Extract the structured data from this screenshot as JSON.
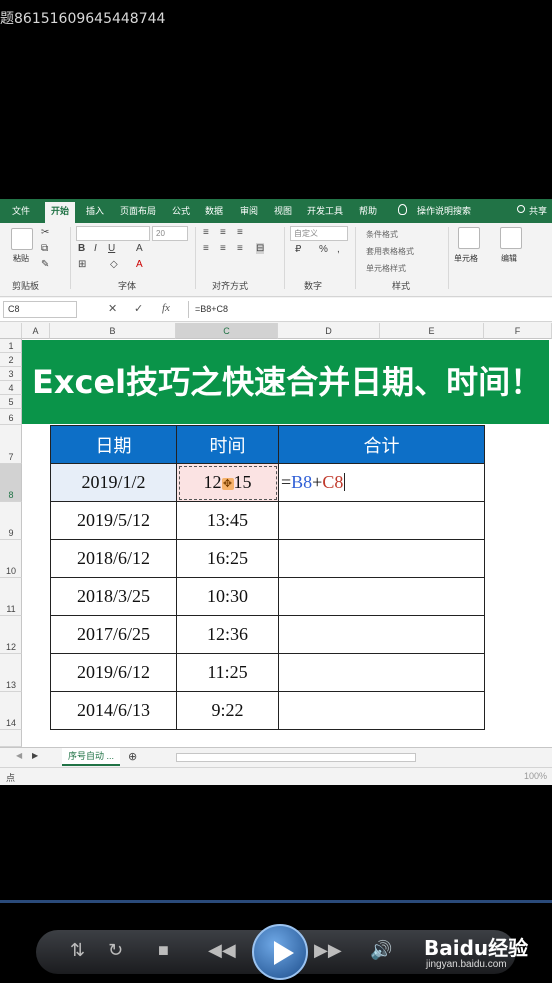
{
  "caption": "题86151609645448744",
  "excel": {
    "tabs": [
      "文件",
      "开始",
      "插入",
      "页面布局",
      "公式",
      "数据",
      "审阅",
      "视图",
      "开发工具",
      "帮助"
    ],
    "tell_me": "操作说明搜索",
    "share": "共享",
    "ribbon": {
      "clipboard_label": "剪贴板",
      "paste_label": "粘贴",
      "font_label": "字体",
      "font_size": "20",
      "align_label": "对齐方式",
      "number_label": "数字",
      "number_format": "自定义",
      "styles_label": "样式",
      "cond_format": "条件格式",
      "table_format": "套用表格格式",
      "cell_styles": "单元格样式",
      "cells_label": "单元格",
      "edit_label": "编辑"
    },
    "name_box": "C8",
    "formula": "=B8+C8",
    "columns": [
      "A",
      "B",
      "C",
      "D",
      "E",
      "F"
    ],
    "rows": [
      "1",
      "2",
      "3",
      "4",
      "5",
      "6",
      "7",
      "8",
      "9",
      "10",
      "11",
      "12",
      "13",
      "14"
    ],
    "banner": "Excel技巧之快速合并日期、时间！",
    "table": {
      "headers": [
        "日期",
        "时间",
        "合计"
      ],
      "rows": [
        [
          "2019/1/2",
          "12:15"
        ],
        [
          "2019/5/12",
          "13:45"
        ],
        [
          "2018/6/12",
          "16:25"
        ],
        [
          "2018/3/25",
          "10:30"
        ],
        [
          "2017/6/25",
          "12:36"
        ],
        [
          "2019/6/12",
          "11:25"
        ],
        [
          "2014/6/13",
          "9:22"
        ]
      ],
      "editing_formula": {
        "eq": "=",
        "ref1": "B8",
        "plus": "+",
        "ref2": "C8"
      }
    },
    "sheet_tab": "序号自动 ...",
    "status_mode": "点",
    "zoom": "100%"
  },
  "watermark": {
    "brand": "Baidu经验",
    "url": "jingyan.baidu.com"
  }
}
